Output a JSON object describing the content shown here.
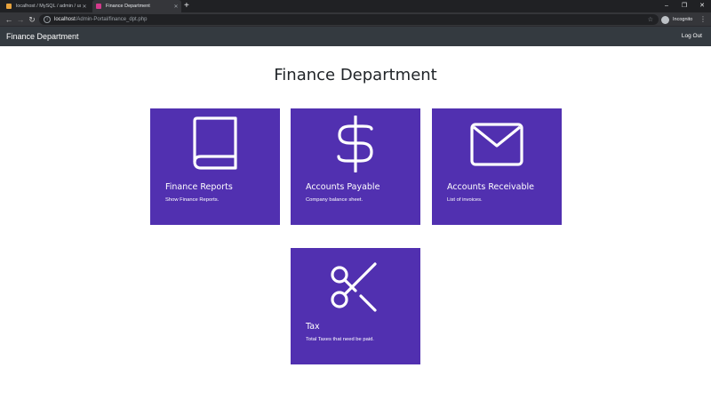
{
  "browser": {
    "tabs": [
      {
        "title": "localhost / MySQL / admin / users",
        "favicon_color": "#e8a33d",
        "active": false
      },
      {
        "title": "Finance Department",
        "favicon_color": "#d43a8c",
        "active": true
      }
    ],
    "address": {
      "host": "localhost",
      "path": "/Admin-Portal/finance_dpt.php"
    },
    "profile_label": "Incognito",
    "icons": {
      "back": "arrow-left-icon",
      "forward": "arrow-right-icon",
      "reload": "reload-icon",
      "new_tab": "plus-icon",
      "bookmark": "star-icon",
      "menu": "kebab-menu-icon"
    }
  },
  "navbar": {
    "brand": "Finance Department",
    "logout_label": "Log Out",
    "bg_color": "#343a40"
  },
  "main": {
    "title": "Finance Department",
    "card_color": "#5130b0",
    "cards": [
      {
        "title": "Finance Reports",
        "description": "Show Finance Reports.",
        "icon": "book-icon"
      },
      {
        "title": "Accounts Payable",
        "description": "Company balance sheet.",
        "icon": "dollar-icon"
      },
      {
        "title": "Accounts Receivable",
        "description": "List of invoices.",
        "icon": "envelope-icon"
      },
      {
        "title": "Tax",
        "description": "Total Taxes that need be paid.",
        "icon": "scissors-icon"
      }
    ]
  }
}
